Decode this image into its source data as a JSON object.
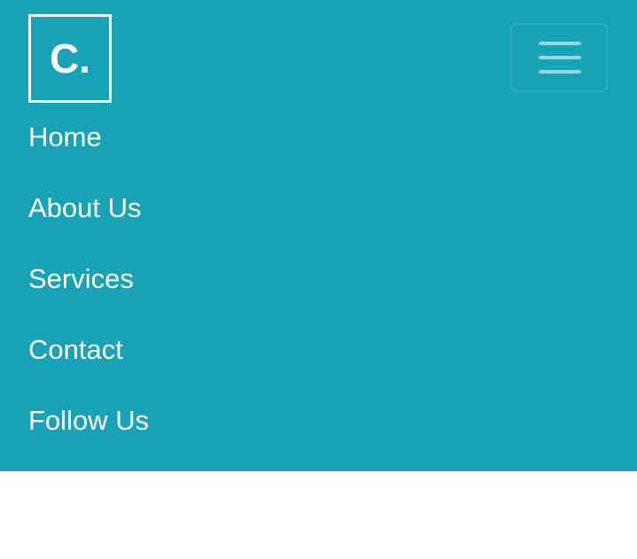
{
  "brand": {
    "logo_text": "C."
  },
  "toggler": {
    "icon": "hamburger-menu-icon"
  },
  "nav": {
    "items": [
      {
        "label": "Home"
      },
      {
        "label": "About Us"
      },
      {
        "label": "Services"
      },
      {
        "label": "Contact"
      },
      {
        "label": "Follow Us"
      }
    ]
  },
  "colors": {
    "navbar_background": "#17a2b8",
    "text": "#ffffff",
    "page_background": "#ffffff"
  }
}
